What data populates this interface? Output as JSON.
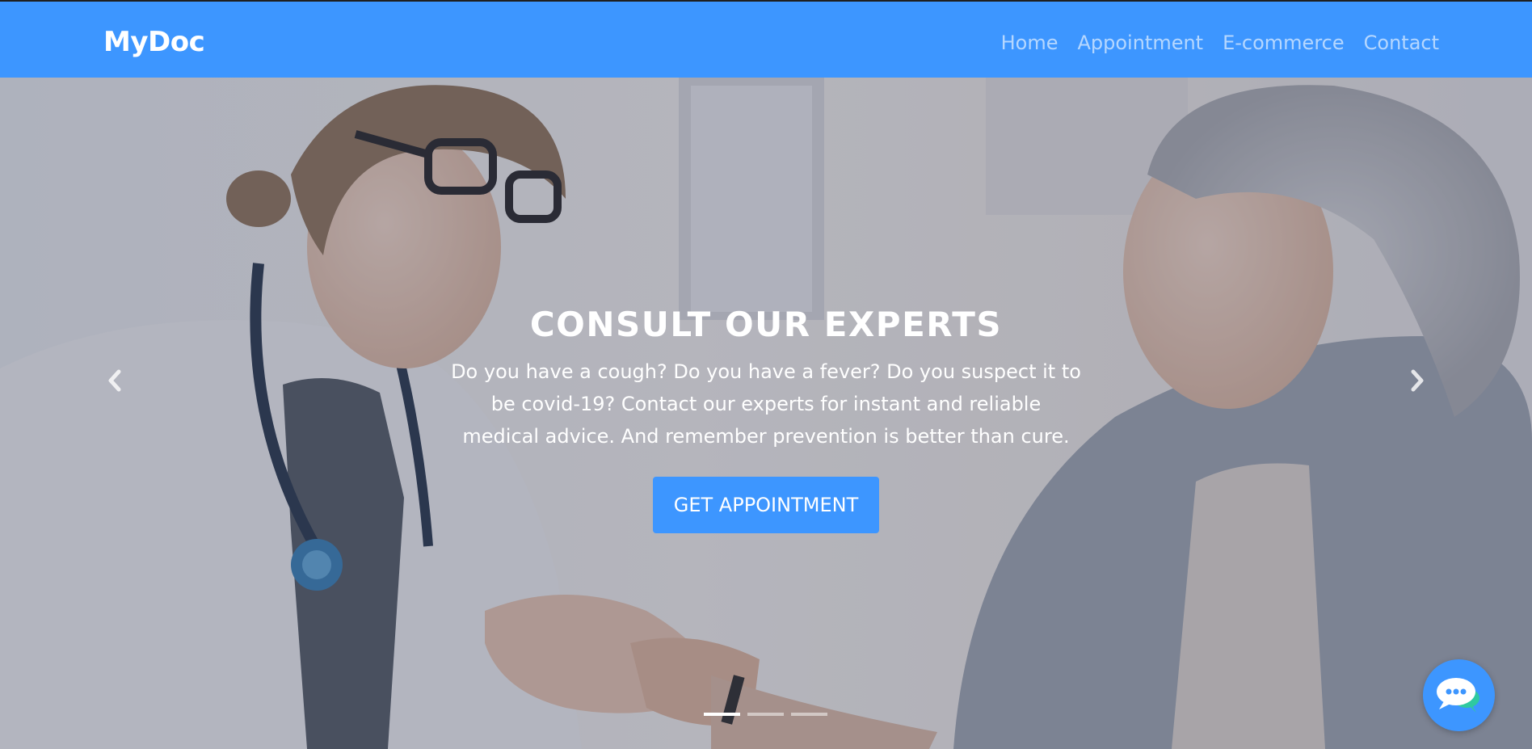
{
  "navbar": {
    "brand": "MyDoc",
    "links": [
      "Home",
      "Appointment",
      "E-commerce",
      "Contact"
    ]
  },
  "hero": {
    "title": "CONSULT OUR EXPERTS",
    "description": "Do you have a cough? Do you have a fever? Do you suspect it to be covid-19? Contact our experts for instant and reliable medical advice. And remember prevention is better than cure.",
    "cta_label": "GET APPOINTMENT",
    "active_slide": 1,
    "slide_count": 3
  },
  "icons": {
    "prev": "chevron-left-icon",
    "next": "chevron-right-icon",
    "chat": "chat-bubble-icon"
  },
  "colors": {
    "primary": "#3d96ff",
    "overlay": "rgba(70,72,95,0.35)",
    "text": "#ffffff"
  }
}
